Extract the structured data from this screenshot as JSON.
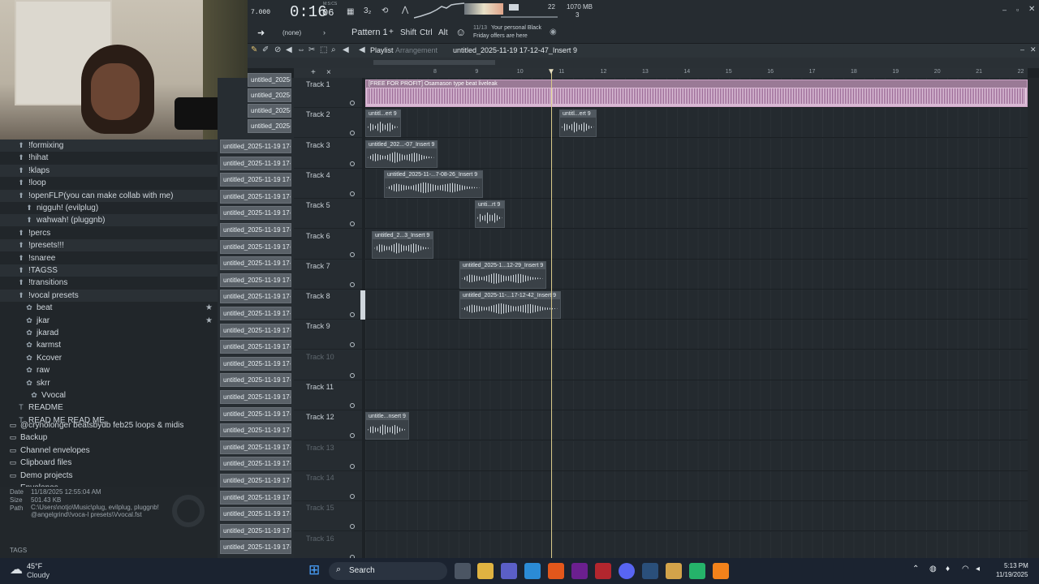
{
  "transport": {
    "time_small": "7.000",
    "time": "0:16",
    "time_sub": "06",
    "time_unit": "M:S:CS",
    "pattern_count": "22",
    "cpu": "1070 MB",
    "voices": "3"
  },
  "toolbar2": {
    "preset": "(none)",
    "pattern": "Pattern 1",
    "shift": "Shift",
    "ctrl": "Ctrl",
    "alt": "Alt",
    "news_date": "11/13",
    "news_text1": "Your personal Black",
    "news_text2": "Friday offers are here"
  },
  "playlist": {
    "label": "Playlist",
    "sub": "Arrangement",
    "title": "untitled_2025-11-19 17-12-47_Insert 9"
  },
  "browser": {
    "items": [
      {
        "label": "!formixing",
        "indent": 20,
        "type": "folder",
        "hl": true
      },
      {
        "label": "!hihat",
        "indent": 20,
        "type": "folder"
      },
      {
        "label": "!klaps",
        "indent": 20,
        "type": "folder",
        "hl": true
      },
      {
        "label": "!loop",
        "indent": 20,
        "type": "folder"
      },
      {
        "label": "!openFLP(you can make collab with me)",
        "indent": 20,
        "type": "folder",
        "hl": true
      },
      {
        "label": "nigguh! (evilplug)",
        "indent": 30,
        "type": "folder"
      },
      {
        "label": "wahwah! (pluggnb)",
        "indent": 30,
        "type": "folder",
        "hl": true
      },
      {
        "label": "!percs",
        "indent": 20,
        "type": "folder"
      },
      {
        "label": "!presets!!!",
        "indent": 20,
        "type": "folder",
        "hl": true
      },
      {
        "label": "!snaree",
        "indent": 20,
        "type": "folder"
      },
      {
        "label": "!TAGSS",
        "indent": 20,
        "type": "folder",
        "hl": true
      },
      {
        "label": "!transitions",
        "indent": 20,
        "type": "folder"
      },
      {
        "label": "!vocal presets",
        "indent": 20,
        "type": "folder",
        "hl": true
      },
      {
        "label": "beat",
        "indent": 30,
        "type": "preset",
        "star": true
      },
      {
        "label": "jkar",
        "indent": 30,
        "type": "preset",
        "star": true
      },
      {
        "label": "jkarad",
        "indent": 30,
        "type": "preset"
      },
      {
        "label": "karmst",
        "indent": 30,
        "type": "preset"
      },
      {
        "label": "Kcover",
        "indent": 30,
        "type": "preset"
      },
      {
        "label": "raw",
        "indent": 30,
        "type": "preset"
      },
      {
        "label": "skrr",
        "indent": 30,
        "type": "preset"
      },
      {
        "label": "Vvocal",
        "indent": 36,
        "type": "preset"
      },
      {
        "label": "README",
        "indent": 20,
        "type": "text"
      },
      {
        "label": "READ ME READ ME",
        "indent": 20,
        "type": "text"
      },
      {
        "label": "@crynolonger beatsbydb feb25 loops & midis",
        "indent": 10,
        "type": "dir"
      },
      {
        "label": "Backup",
        "indent": 10,
        "type": "dir"
      },
      {
        "label": "Channel envelopes",
        "indent": 10,
        "type": "dir"
      },
      {
        "label": "Clipboard files",
        "indent": 10,
        "type": "dir"
      },
      {
        "label": "Demo projects",
        "indent": 10,
        "type": "dir"
      },
      {
        "label": "Envelopes",
        "indent": 10,
        "type": "dir"
      }
    ],
    "info": {
      "date_label": "Date",
      "date": "11/18/2025 12:55:04 AM",
      "size_label": "Size",
      "size": "501.43 KB",
      "path_label": "Path",
      "path": "C:\\Users\\notjo\\Music\\plug, evilplug, pluggnb! @angelgrind\\!voca-l presets\\Vvocal.fst",
      "tags": "TAGS"
    }
  },
  "patterns": {
    "item": "untitled_2025-11-19 17-...",
    "count_top": 4
  },
  "tracks": [
    "Track 1",
    "Track 2",
    "Track 3",
    "Track 4",
    "Track 5",
    "Track 6",
    "Track 7",
    "Track 8",
    "Track 9",
    "Track 10",
    "Track 11",
    "Track 12",
    "Track 13",
    "Track 14",
    "Track 15",
    "Track 16"
  ],
  "ruler": [
    "8",
    "9",
    "10",
    "11",
    "12",
    "13",
    "14",
    "15",
    "16",
    "17",
    "18",
    "19",
    "20",
    "21",
    "22"
  ],
  "clips": [
    {
      "label": "[FREE FOR PROFIT] Osamason type beat liveleak",
      "track": 0,
      "start": 0,
      "len": 816,
      "main": true
    },
    {
      "label": "untitl...ert 9",
      "track": 1,
      "start": 0,
      "len": 44
    },
    {
      "label": "untitl...ert 9",
      "track": 1,
      "start": 239,
      "len": 46
    },
    {
      "label": "untitled_202...-07_Insert 9",
      "track": 2,
      "start": 0,
      "len": 89
    },
    {
      "label": "untitled_2025-11-...7-08-26_Insert 9",
      "track": 3,
      "start": 23,
      "len": 122
    },
    {
      "label": "unti...rt 9",
      "track": 4,
      "start": 135,
      "len": 37
    },
    {
      "label": "untitled_2...3_Insert 9",
      "track": 5,
      "start": 8,
      "len": 76
    },
    {
      "label": "untitled_2025-1...12-29_Insert 9",
      "track": 6,
      "start": 116,
      "len": 107
    },
    {
      "label": "untitled_2025-11-...17-12-42_Insert 9",
      "track": 7,
      "start": 116,
      "len": 125
    },
    {
      "label": "untitle...nsert 9",
      "track": 11,
      "start": 0,
      "len": 54
    }
  ],
  "taskbar": {
    "temp": "45°F",
    "weather": "Cloudy",
    "search": "Search",
    "time": "5:13 PM",
    "date": "11/19/2025"
  }
}
